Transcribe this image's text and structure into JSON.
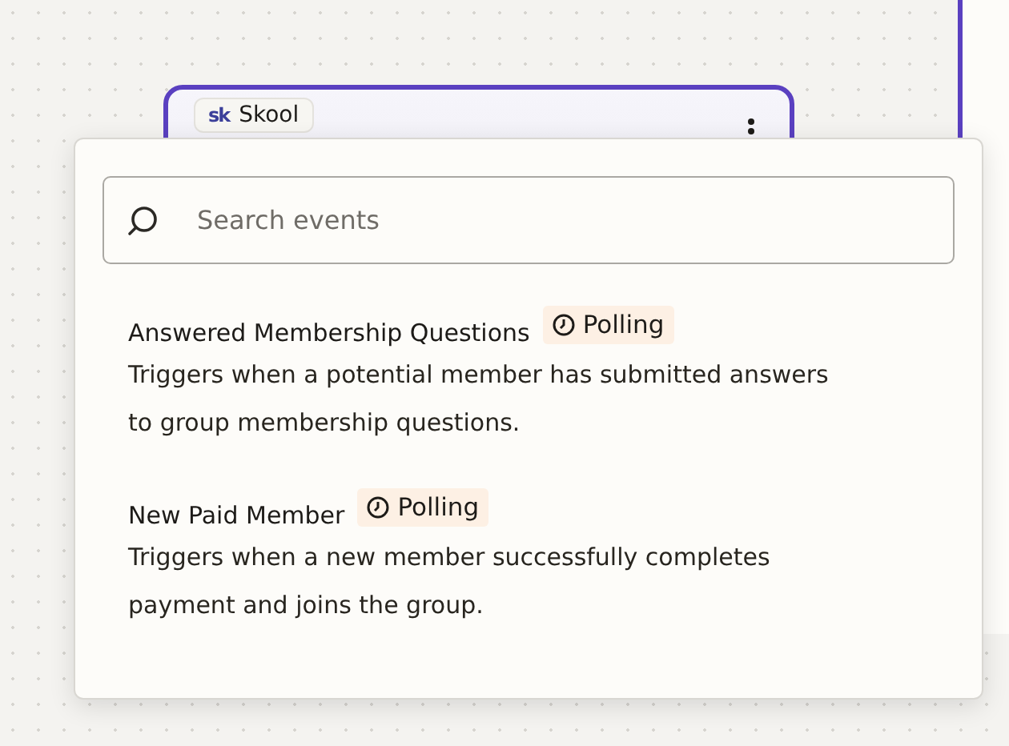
{
  "node": {
    "logo": "sk",
    "app_name": "Skool"
  },
  "search": {
    "placeholder": "Search events"
  },
  "events": [
    {
      "title": "Answered Membership Questions",
      "badge": "Polling",
      "description": "Triggers when a potential member has submitted answers to group membership questions."
    },
    {
      "title": "New Paid Member",
      "badge": "Polling",
      "description": "Triggers when a new member successfully completes payment and joins the group."
    }
  ]
}
